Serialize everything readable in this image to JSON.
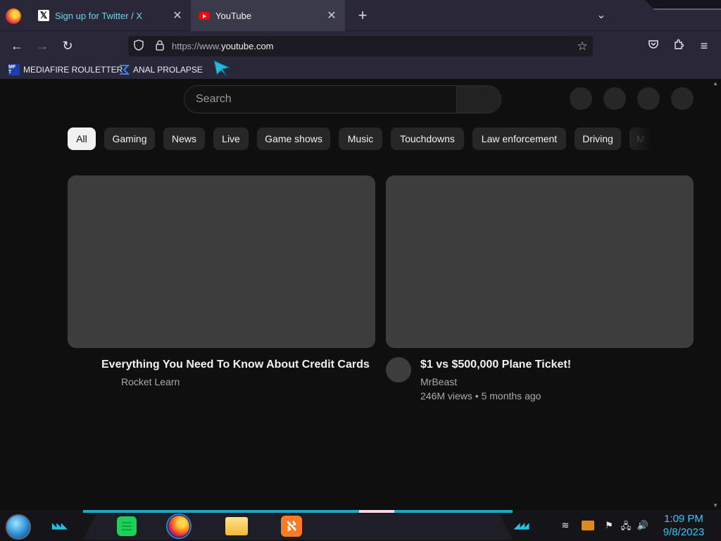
{
  "tabs": [
    {
      "title": "Sign up for Twitter / X",
      "favicon": "x-logo-icon",
      "active": false
    },
    {
      "title": "YouTube",
      "favicon": "youtube-logo-icon",
      "active": true
    }
  ],
  "toolbar": {
    "url_prefix": "https://www.",
    "url_domain": "youtube.com"
  },
  "bookmarks": [
    {
      "label": "MEDIAFIRE ROULETTER",
      "icon_text": "MF T"
    },
    {
      "label": "ANAL PROLAPSE"
    }
  ],
  "youtube": {
    "search_placeholder": "Search",
    "chips": [
      "All",
      "Gaming",
      "News",
      "Live",
      "Game shows",
      "Music",
      "Touchdowns",
      "Law enforcement",
      "Driving",
      "M"
    ],
    "videos": [
      {
        "title": "Everything You Need To Know About Credit Cards",
        "channel": "Rocket Learn",
        "stats": ""
      },
      {
        "title": "$1 vs $500,000 Plane Ticket!",
        "channel": "MrBeast",
        "stats": "246M views • 5 months ago"
      }
    ]
  },
  "taskbar": {
    "time": "1:09 PM",
    "date": "9/8/2023"
  },
  "colors": {
    "page_bg": "#0f0f0f",
    "chip_bg": "#272727",
    "chip_active_bg": "#f1f1f1",
    "thumb_placeholder": "#3d3d3d",
    "twitter_tab_text": "#6fd3e8",
    "clock": "#36c7f0"
  }
}
